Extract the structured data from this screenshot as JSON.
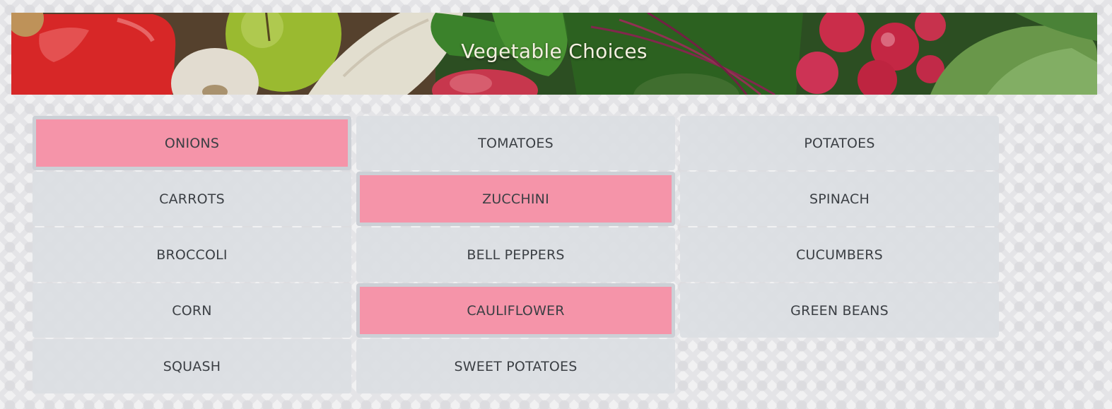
{
  "header": {
    "title": "Vegetable Choices"
  },
  "choices": [
    {
      "label": "ONIONS",
      "selected": true
    },
    {
      "label": "TOMATOES",
      "selected": false
    },
    {
      "label": "POTATOES",
      "selected": false
    },
    {
      "label": "CARROTS",
      "selected": false
    },
    {
      "label": "ZUCCHINI",
      "selected": true
    },
    {
      "label": "SPINACH",
      "selected": false
    },
    {
      "label": "BROCCOLI",
      "selected": false
    },
    {
      "label": "BELL PEPPERS",
      "selected": false
    },
    {
      "label": "CUCUMBERS",
      "selected": false
    },
    {
      "label": "CORN",
      "selected": false
    },
    {
      "label": "CAULIFLOWER",
      "selected": true
    },
    {
      "label": "GREEN BEANS",
      "selected": false
    },
    {
      "label": "SQUASH",
      "selected": false
    },
    {
      "label": "SWEET POTATOES",
      "selected": false
    }
  ],
  "colors": {
    "selected": "#f594a9",
    "unselected": "#dbdee3",
    "text": "#3b3f44"
  }
}
